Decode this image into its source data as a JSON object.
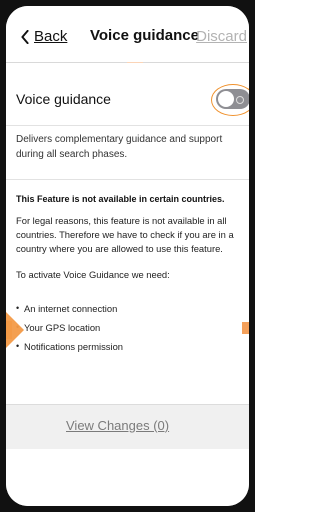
{
  "nav": {
    "back_label": "Back",
    "title": "Voice guidance",
    "discard_label": "Discard"
  },
  "settings": {
    "voice_guidance_label": "Voice guidance",
    "voice_guidance_enabled": false,
    "description": "Delivers complementary guidance and support during all search phases."
  },
  "notice": {
    "title": "This Feature is not available in certain countries.",
    "body": "For legal reasons, this feature is not available in all countries. Therefore we have to check if you are in a country where you are allowed to use this feature.",
    "activate_text": "To activate Voice Guidance we need:",
    "requirements": [
      "An internet connection",
      "Your GPS location",
      "Notifications permission"
    ]
  },
  "footer": {
    "view_changes_label": "View Changes (0)"
  },
  "colors": {
    "accent_orange": "#f0922e",
    "toggle_off": "#8e8e93",
    "disabled_text": "#b3b3b3"
  },
  "icons": {
    "back": "chevron-left-icon"
  }
}
